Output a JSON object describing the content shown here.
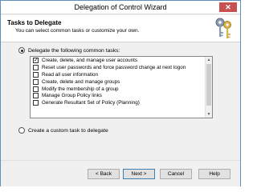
{
  "window": {
    "title": "Delegation of Control Wizard",
    "close_glyph": "✕"
  },
  "header": {
    "title": "Tasks to Delegate",
    "subtitle": "You can select common tasks or customize your own.",
    "icon": "keys-icon"
  },
  "options": {
    "common_label": "Delegate the following common tasks:",
    "custom_label": "Create a custom task to delegate",
    "selected": "common"
  },
  "tasks": [
    {
      "label": "Create, delete, and manage user accounts",
      "checked": true
    },
    {
      "label": "Reset user passwords and force password change at next logon",
      "checked": false
    },
    {
      "label": "Read all user information",
      "checked": false
    },
    {
      "label": "Create, delete and manage groups",
      "checked": false
    },
    {
      "label": "Modify the membership of a group",
      "checked": false
    },
    {
      "label": "Manage Group Policy links",
      "checked": false
    },
    {
      "label": "Generate Resultant Set of Policy (Planning)",
      "checked": false
    }
  ],
  "buttons": {
    "back": "< Back",
    "next": "Next >",
    "cancel": "Cancel",
    "help": "Help"
  }
}
